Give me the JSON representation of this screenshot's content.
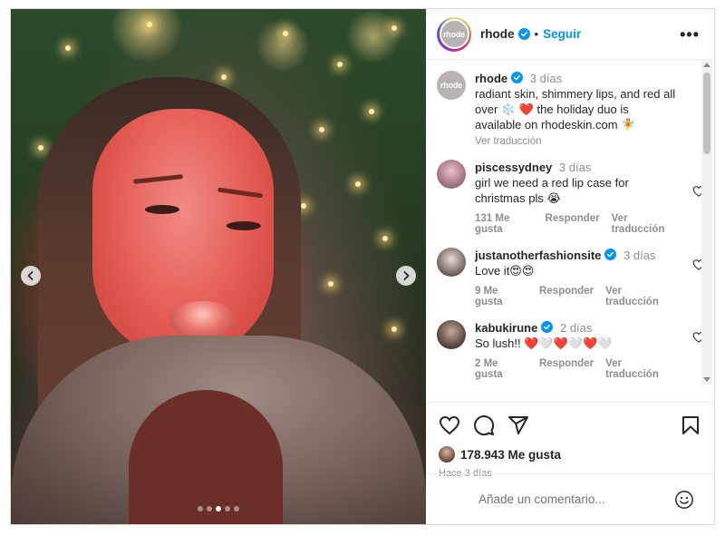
{
  "post": {
    "username": "rhode",
    "avatar_text": "rhode",
    "follow_label": "Seguir",
    "separator": "•",
    "carousel": {
      "slides": 5,
      "active_index": 2
    }
  },
  "caption": {
    "username": "rhode",
    "time": "3 días",
    "text_1": "radiant skin, shimmery lips, and red all over",
    "text_2": "the holiday duo is available on rhodeskin.com",
    "emoji_1": "❄️",
    "emoji_2": "❤️",
    "emoji_3": "🧚",
    "translation": "Ver traducción"
  },
  "comments": [
    {
      "username": "piscessydney",
      "verified": false,
      "time": "3 días",
      "text": "girl we need a red lip case for christmas pls 😭",
      "likes": "131 Me gusta",
      "reply": "Responder",
      "translation": "Ver traducción"
    },
    {
      "username": "justanotherfashionsite",
      "verified": true,
      "time": "3 días",
      "text": "Love it😍😍",
      "likes": "9 Me gusta",
      "reply": "Responder",
      "translation": "Ver traducción"
    },
    {
      "username": "kabukirune",
      "verified": true,
      "time": "2 días",
      "text": "So lush!! ❤️🤍❤️🤍❤️🤍",
      "likes": "2 Me gusta",
      "reply": "Responder",
      "translation": "Ver traducción"
    }
  ],
  "stats": {
    "likes": "178.943 Me gusta",
    "posted": "Hace 3 días"
  },
  "composer": {
    "placeholder": "Añade un comentario..."
  },
  "colors": {
    "accent": "#0095f6",
    "verified": "#0095f6",
    "muted": "#8e8e8e"
  }
}
